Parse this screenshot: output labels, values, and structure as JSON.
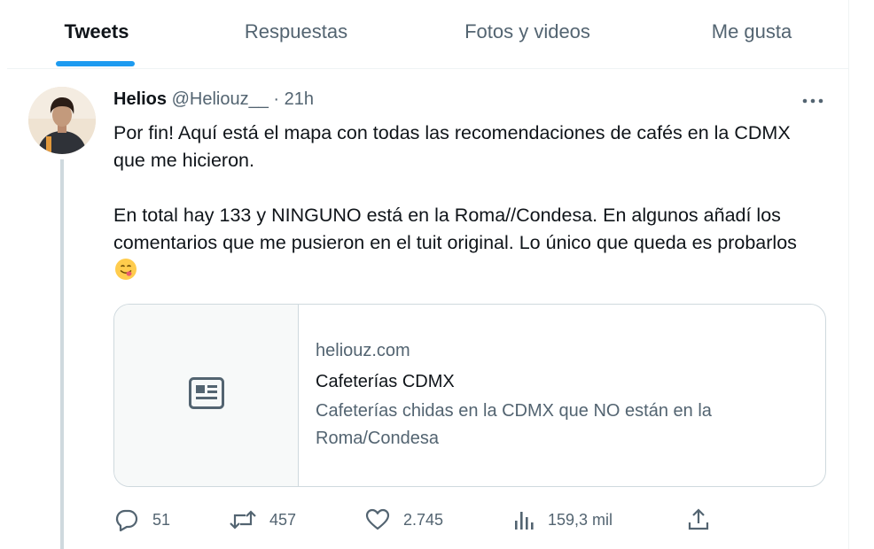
{
  "tabs": [
    {
      "label": "Tweets",
      "active": true
    },
    {
      "label": "Respuestas",
      "active": false
    },
    {
      "label": "Fotos y videos",
      "active": false
    },
    {
      "label": "Me gusta",
      "active": false
    }
  ],
  "tweet": {
    "display_name": "Helios",
    "handle": "@Heliouz__",
    "separator": "·",
    "time": "21h",
    "paragraph_1": "Por fin! Aquí está el mapa con todas las recomendaciones de cafés en la CDMX que me hicieron.",
    "paragraph_2": "En total hay 133 y NINGUNO está en la Roma//Condesa. En algunos añadí los comentarios que me pusieron en el tuit original. Lo único que queda es probarlos",
    "emoji": "face-savoring-food"
  },
  "card": {
    "domain": "heliouz.com",
    "title": "Cafeterías CDMX",
    "description": "Cafeterías chidas en la CDMX que NO están en la Roma/Condesa"
  },
  "actions": {
    "replies": "51",
    "retweets": "457",
    "likes": "2.745",
    "views": "159,3 mil"
  },
  "icons": [
    "more-icon",
    "article-icon",
    "reply-icon",
    "retweet-icon",
    "like-icon",
    "views-icon",
    "share-icon"
  ],
  "colors": {
    "accent": "#1d9bf0",
    "muted": "#536471",
    "text": "#0f1419",
    "border": "#cfd9de"
  }
}
